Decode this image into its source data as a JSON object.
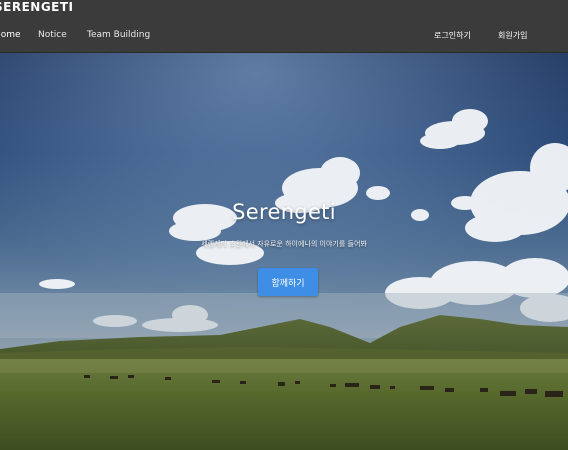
{
  "header": {
    "brand": "SERENGETI",
    "nav": [
      {
        "label": "Home"
      },
      {
        "label": "Notice"
      },
      {
        "label": "Team Building"
      }
    ],
    "login_label": "로그인하기",
    "signup_label": "회원가입"
  },
  "hero": {
    "title": "Serengeti",
    "subtitle": "세렝게티 초원에서 자유로운 하이에나의 이야기를 들어봐",
    "cta_label": "함께하기"
  }
}
